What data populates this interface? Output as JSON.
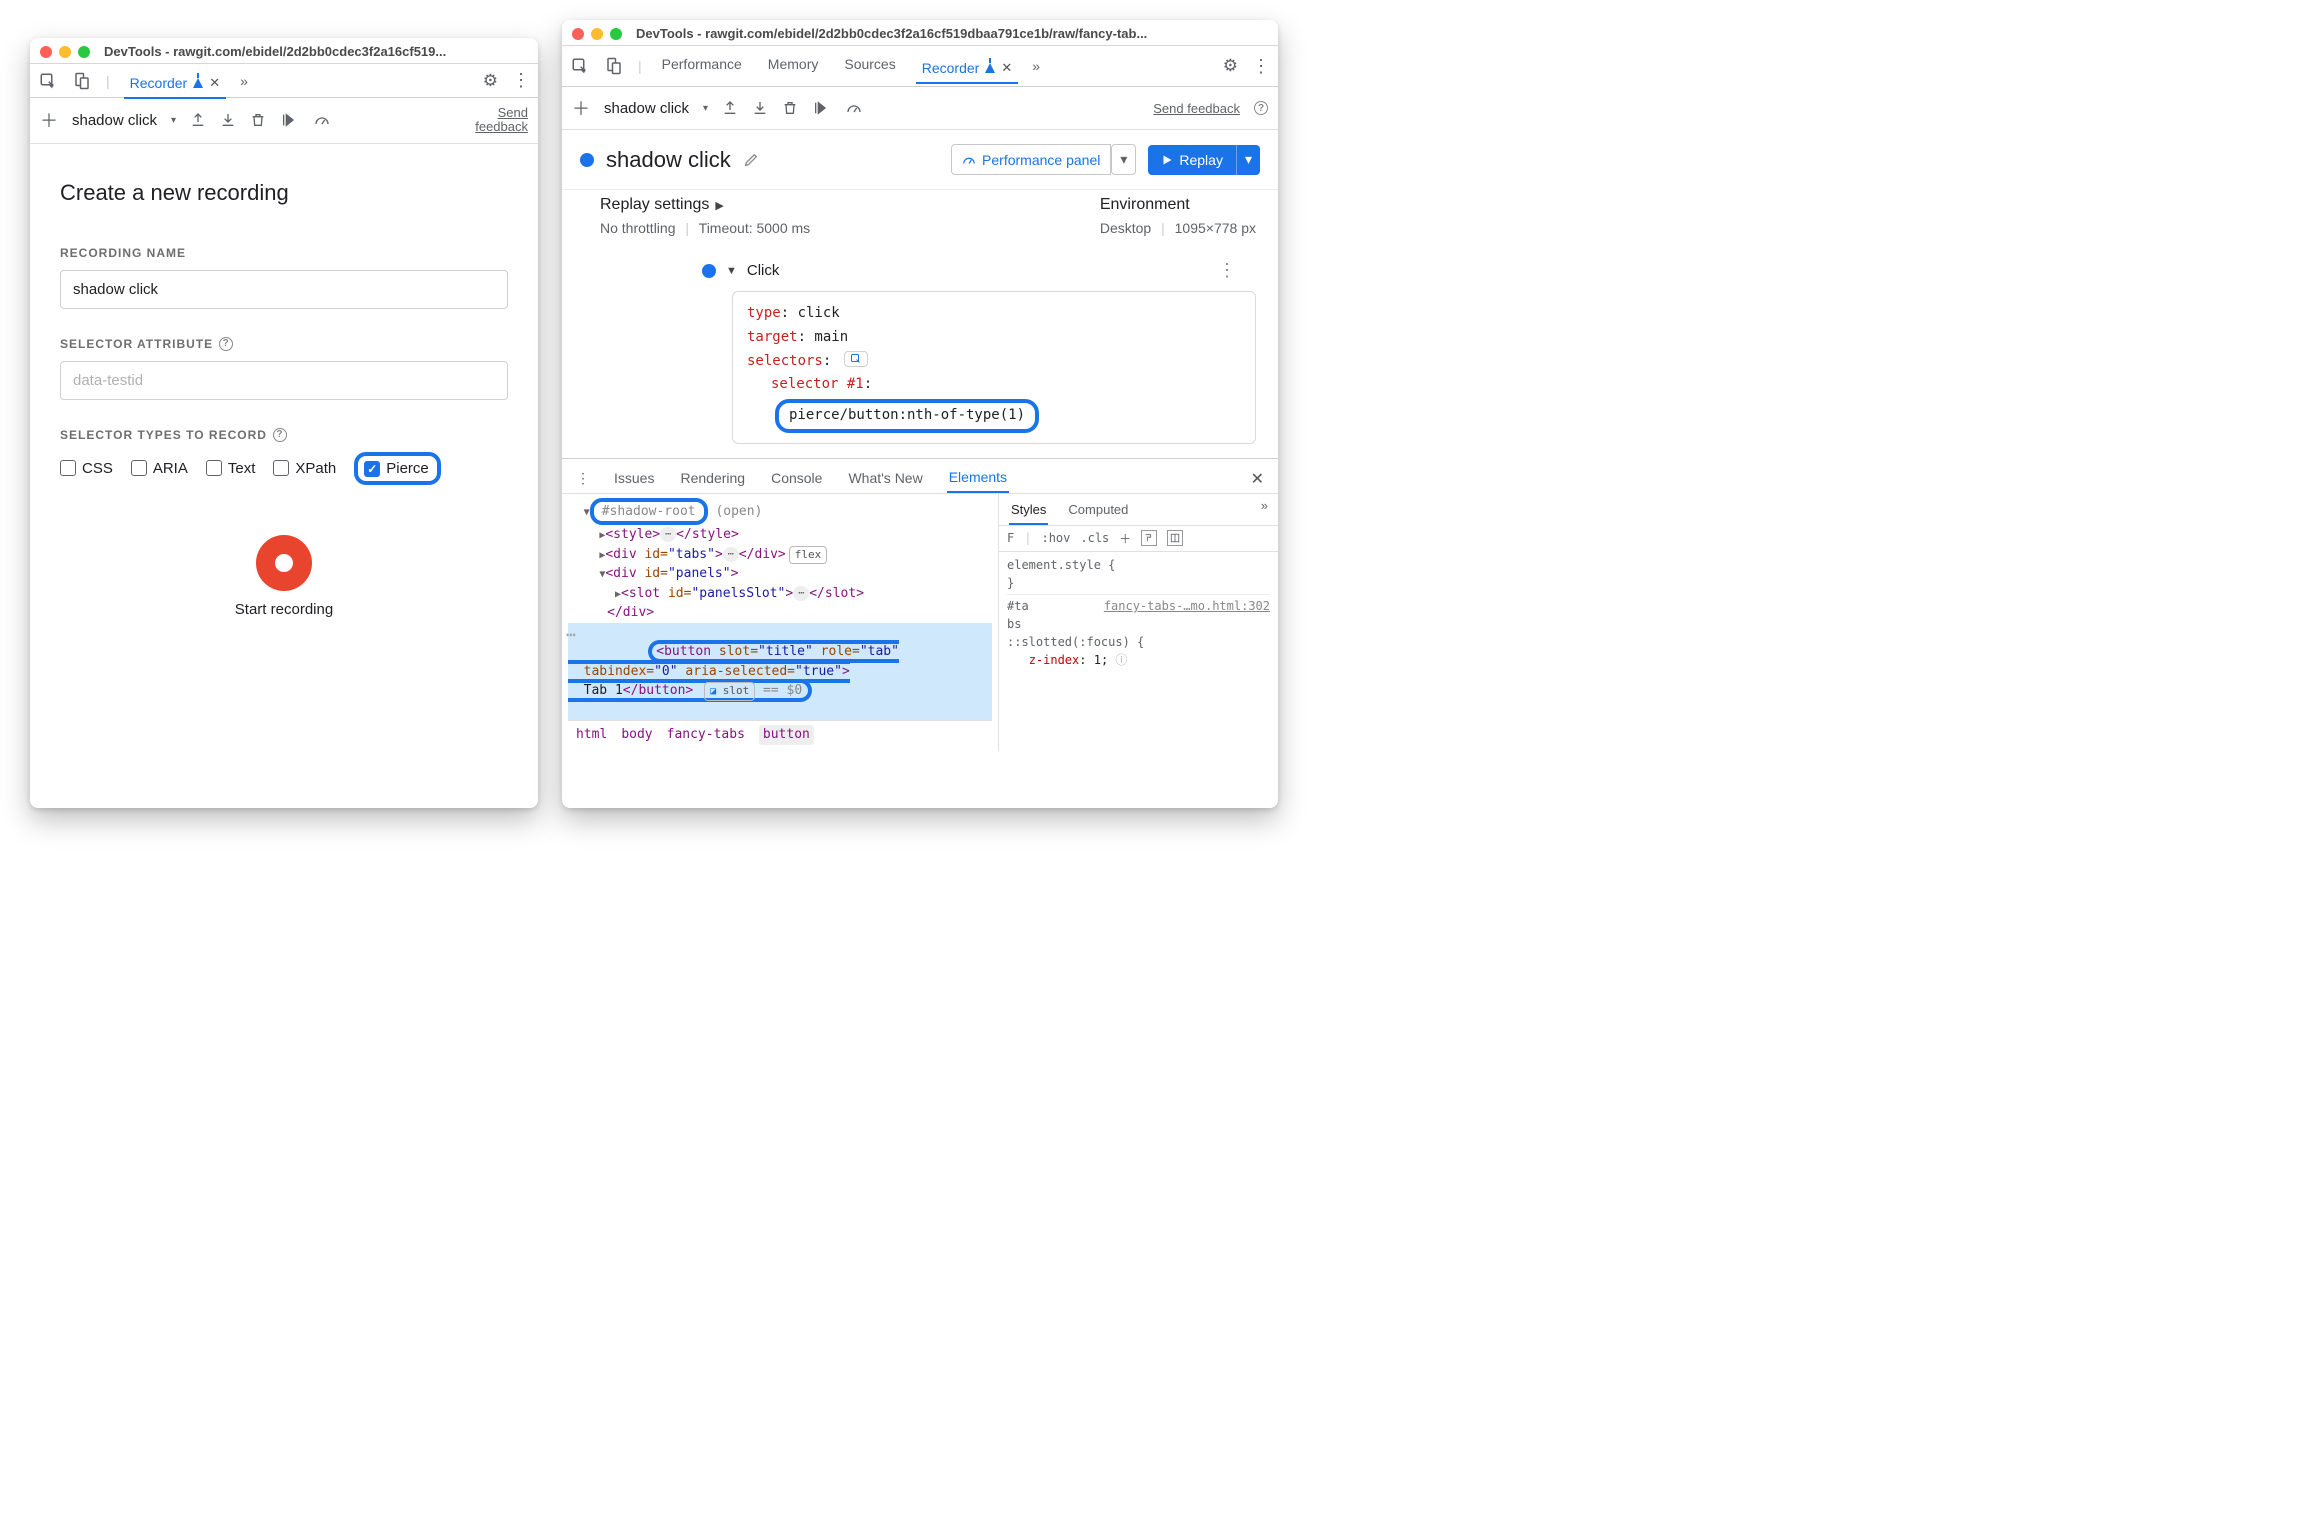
{
  "win1": {
    "title": "DevTools - rawgit.com/ebidel/2d2bb0cdec3f2a16cf519...",
    "tabs": {
      "recorder": "Recorder"
    },
    "toolbar": {
      "recording_name": "shadow click",
      "feedback": "Send feedback"
    },
    "create": {
      "title": "Create a new recording",
      "name_label": "RECORDING NAME",
      "name_value": "shadow click",
      "selector_attr_label": "SELECTOR ATTRIBUTE",
      "selector_attr_placeholder": "data-testid",
      "types_label": "SELECTOR TYPES TO RECORD",
      "types": [
        "CSS",
        "ARIA",
        "Text",
        "XPath",
        "Pierce"
      ],
      "start": "Start recording"
    }
  },
  "win2": {
    "title": "DevTools - rawgit.com/ebidel/2d2bb0cdec3f2a16cf519dbaa791ce1b/raw/fancy-tab...",
    "tabs": {
      "performance": "Performance",
      "memory": "Memory",
      "sources": "Sources",
      "recorder": "Recorder"
    },
    "toolbar": {
      "recording_name": "shadow click",
      "feedback": "Send feedback"
    },
    "header": {
      "rec_name": "shadow click",
      "perf_panel": "Performance panel",
      "replay": "Replay"
    },
    "settings": {
      "replay_heading": "Replay settings",
      "throttling": "No throttling",
      "timeout": "Timeout: 5000 ms",
      "env_heading": "Environment",
      "device": "Desktop",
      "viewport": "1095×778 px"
    },
    "step": {
      "name": "Click",
      "lines": {
        "type_k": "type",
        "type_v": ": click",
        "target_k": "target",
        "target_v": ": main",
        "selectors_k": "selectors",
        "selectors_v": ":",
        "sel1_k": "selector #1",
        "sel1_v": ":"
      },
      "pierce": "pierce/button:nth-of-type(1)"
    },
    "drawer": {
      "tabs": [
        "Issues",
        "Rendering",
        "Console",
        "What's New",
        "Elements"
      ],
      "tree": {
        "shadow": "#shadow-root",
        "shadow_open": "(open)",
        "style_open": "<style>",
        "style_close": "</style>",
        "tabs_open": "<div id=\"tabs\">",
        "tabs_close": "</div>",
        "flex": "flex",
        "panels_open": "<div id=\"panels\">",
        "slot_open": "<slot id=\"panelsSlot\">",
        "slot_close": "</slot>",
        "panels_close": "</div>",
        "button_l1": "<button slot=\"title\" role=\"tab\"",
        "button_l2": "tabindex=\"0\" aria-selected=\"true\">",
        "button_l3_a": "Tab 1",
        "button_l3_b": "</button>",
        "slot_badge": "slot",
        "eqvar": " == $0"
      },
      "crumbs": [
        "html",
        "body",
        "fancy-tabs",
        "button"
      ],
      "styles": {
        "tabs": [
          "Styles",
          "Computed"
        ],
        "filter_placeholder": "F",
        "hov": ":hov",
        "cls": ".cls",
        "rule1": "element.style {",
        "rule1c": "}",
        "rule2_sel": "#ta\nbs",
        "rule2_file": "fancy-tabs-…mo.html:302",
        "rule2_a": "::slotted(:focus) {",
        "rule2_prop": "z-index",
        "rule2_val": ": 1;"
      }
    }
  }
}
